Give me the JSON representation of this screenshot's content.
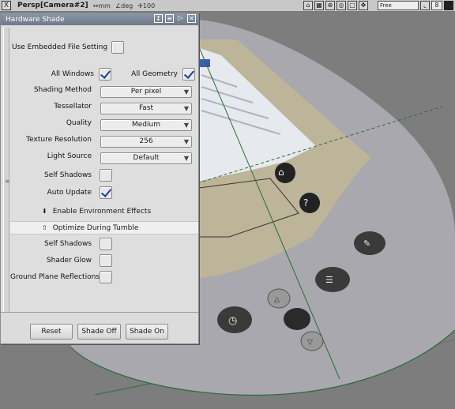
{
  "topbar": {
    "close_glyph": "X",
    "title": "Persp[Camera#2]",
    "unit_mm": "↔mm",
    "unit_deg": "∠deg",
    "unit_scale": "✛100",
    "field_value": "Free",
    "small_field": "8"
  },
  "panel": {
    "title": "Hardware Shade",
    "use_embedded_label": "Use Embedded File Setting",
    "all_windows_label": "All Windows",
    "all_geometry_label": "All Geometry",
    "shading_method_label": "Shading Method",
    "shading_method_value": "Per pixel",
    "tessellator_label": "Tessellator",
    "tessellator_value": "Fast",
    "quality_label": "Quality",
    "quality_value": "Medium",
    "texture_res_label": "Texture Resolution",
    "texture_res_value": "256",
    "light_source_label": "Light Source",
    "light_source_value": "Default",
    "self_shadows_label": "Self Shadows",
    "auto_update_label": "Auto Update",
    "env_effects_label": "Enable Environment Effects",
    "optimize_tumble_label": "Optimize During Tumble",
    "self_shadows2_label": "Self Shadows",
    "shader_glow_label": "Shader Glow",
    "ground_plane_label": "Ground Plane Reflections",
    "reset_label": "Reset",
    "shade_off_label": "Shade Off",
    "shade_on_label": "Shade On"
  },
  "checkbox_state": {
    "use_embedded": false,
    "all_windows": true,
    "all_geometry": true,
    "self_shadows": false,
    "auto_update": true,
    "self_shadows2": false,
    "shader_glow": false,
    "ground_plane": false
  },
  "colors": {
    "panel_title_bg": "#7c8797",
    "checkmark": "#1b3e8a",
    "device_body": "#a9a9b0",
    "display_area": "#bdb69a"
  }
}
